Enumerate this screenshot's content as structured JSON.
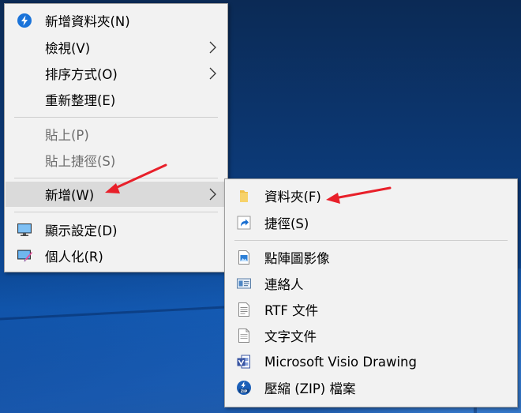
{
  "context_menu": {
    "items": [
      {
        "label": "新增資料夾(N)",
        "icon": "new-folder-icon"
      },
      {
        "label": "檢視(V)",
        "submenu": true
      },
      {
        "label": "排序方式(O)",
        "submenu": true
      },
      {
        "label": "重新整理(E)"
      },
      {
        "label": "貼上(P)",
        "disabled": true
      },
      {
        "label": "貼上捷徑(S)",
        "disabled": true
      },
      {
        "label": "新增(W)",
        "submenu": true,
        "highlighted": true
      },
      {
        "label": "顯示設定(D)",
        "icon": "monitor-icon"
      },
      {
        "label": "個人化(R)",
        "icon": "personalize-icon"
      }
    ]
  },
  "new_submenu": {
    "items": [
      {
        "label": "資料夾(F)",
        "icon": "folder-icon"
      },
      {
        "label": "捷徑(S)",
        "icon": "shortcut-icon"
      },
      {
        "label": "點陣圖影像",
        "icon": "bitmap-icon"
      },
      {
        "label": "連絡人",
        "icon": "contact-card-icon"
      },
      {
        "label": "RTF 文件",
        "icon": "rtf-document-icon"
      },
      {
        "label": "文字文件",
        "icon": "text-document-icon"
      },
      {
        "label": "Microsoft Visio Drawing",
        "icon": "visio-icon"
      },
      {
        "label": "壓縮 (ZIP) 檔案",
        "icon": "zip-icon"
      }
    ]
  },
  "colors": {
    "menu_bg": "#f2f2f2",
    "highlight_bg": "#dadada",
    "disabled_text": "#6d6d6d",
    "annotation_arrow": "#e8202a"
  }
}
